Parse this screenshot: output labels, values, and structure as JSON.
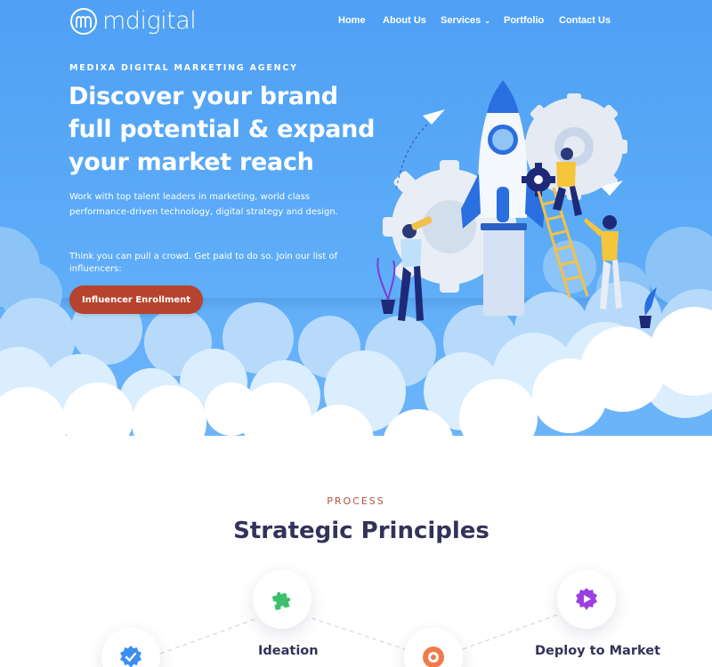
{
  "brand": {
    "name": "mdigital"
  },
  "nav": {
    "items": [
      {
        "label": "Home"
      },
      {
        "label": "About Us"
      },
      {
        "label": "Services"
      },
      {
        "label": "Portfolio"
      },
      {
        "label": "Contact Us"
      }
    ]
  },
  "hero": {
    "eyebrow": "MEDIXA DIGITAL MARKETING AGENCY",
    "headline": "Discover your brand full potential & expand your market reach",
    "description": "Work with top talent leaders in marketing, world class performance-driven technology, digital strategy and design.",
    "influencer_text": "Think you can pull a crowd. Get paid to do so. Join our list of influencers:",
    "cta_label": "Influencer Enrollment"
  },
  "process": {
    "eyebrow": "PROCESS",
    "title": "Strategic Principles",
    "steps": [
      {
        "label": "",
        "icon": "checkmark-badge-icon"
      },
      {
        "label": "Ideation",
        "icon": "puzzle-icon"
      },
      {
        "label": "",
        "icon": "target-icon"
      },
      {
        "label": "Deploy to Market",
        "icon": "play-badge-icon"
      }
    ]
  },
  "colors": {
    "hero_blue": "#5aaaf7",
    "cta": "#b6432e",
    "accent_text": "#b4513e",
    "heading_dark": "#33325a",
    "rocket_blue": "#2a6fe0",
    "gear_gray": "#e6ebf3"
  }
}
